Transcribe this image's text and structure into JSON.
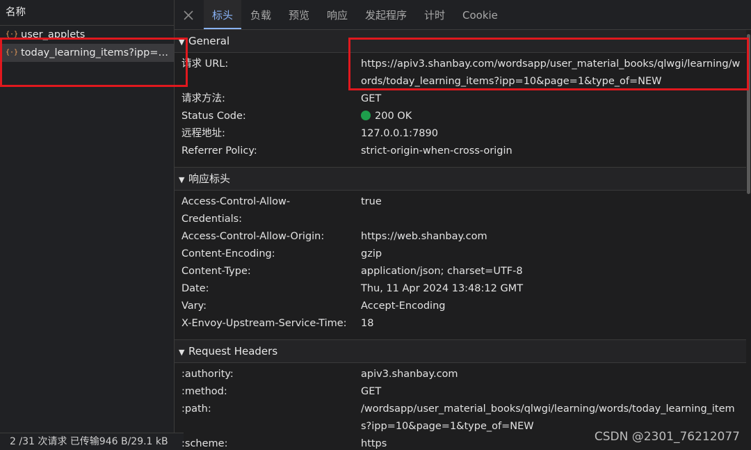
{
  "left": {
    "header": "名称",
    "requests": [
      {
        "name": "user_applets",
        "icon": "json-icon"
      },
      {
        "name": "today_learning_items?ipp=1...",
        "icon": "json-icon",
        "selected": true
      }
    ],
    "footer": "2 /31 次请求  已传输946 B/29.1 kB"
  },
  "tabs": [
    "标头",
    "负载",
    "预览",
    "响应",
    "发起程序",
    "计时",
    "Cookie"
  ],
  "active_tab": "标头",
  "general": {
    "title": "General",
    "rows": [
      {
        "key": "请求 URL:",
        "value": "https://apiv3.shanbay.com/wordsapp/user_material_books/qlwgi/learning/words/today_learning_items?ipp=10&page=1&type_of=NEW"
      },
      {
        "key": "请求方法:",
        "value": "GET"
      },
      {
        "key": "Status Code:",
        "value": "200 OK"
      },
      {
        "key": "远程地址:",
        "value": "127.0.0.1:7890"
      },
      {
        "key": "Referrer Policy:",
        "value": "strict-origin-when-cross-origin"
      }
    ],
    "status_color": "#1e9e4c"
  },
  "response_headers": {
    "title": "响应标头",
    "rows": [
      {
        "key": "Access-Control-Allow-Credentials:",
        "value": "true"
      },
      {
        "key": "Access-Control-Allow-Origin:",
        "value": "https://web.shanbay.com"
      },
      {
        "key": "Content-Encoding:",
        "value": "gzip"
      },
      {
        "key": "Content-Type:",
        "value": "application/json; charset=UTF-8"
      },
      {
        "key": "Date:",
        "value": "Thu, 11 Apr 2024 13:48:12 GMT"
      },
      {
        "key": "Vary:",
        "value": "Accept-Encoding"
      },
      {
        "key": "X-Envoy-Upstream-Service-Time:",
        "value": "18"
      }
    ]
  },
  "request_headers": {
    "title": "Request Headers",
    "rows": [
      {
        "key": ":authority:",
        "value": "apiv3.shanbay.com"
      },
      {
        "key": ":method:",
        "value": "GET"
      },
      {
        "key": ":path:",
        "value": "/wordsapp/user_material_books/qlwgi/learning/words/today_learning_items?ipp=10&page=1&type_of=NEW"
      },
      {
        "key": ":scheme:",
        "value": "https"
      }
    ]
  },
  "watermark": "CSDN @2301_76212077",
  "colors": {
    "accent": "#8ab4f8",
    "annotation": "#e0181e",
    "status_ok": "#1e9e4c"
  }
}
